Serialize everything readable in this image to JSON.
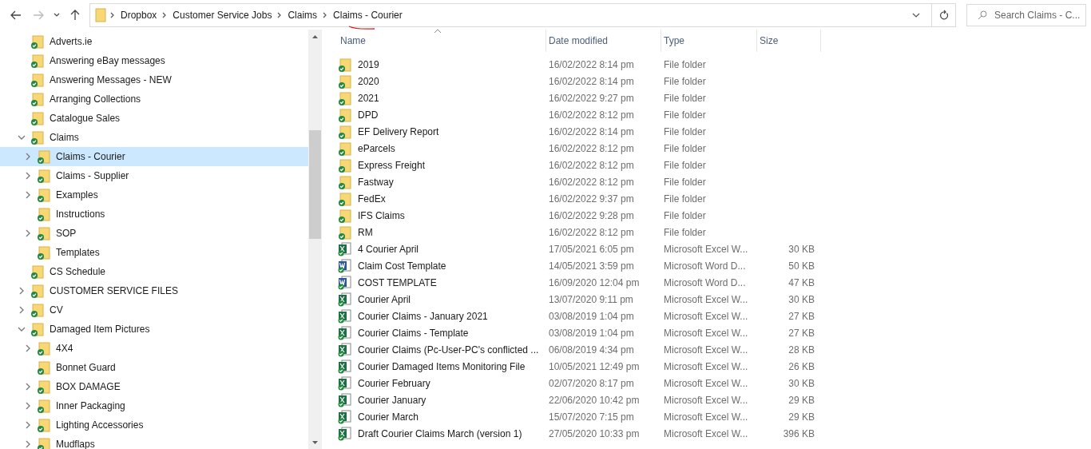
{
  "address_bar": {
    "path": [
      "Dropbox",
      "Customer Service Jobs",
      "Claims",
      "Claims - Courier"
    ]
  },
  "search": {
    "placeholder": "Search Claims - C..."
  },
  "sidebar": {
    "items": [
      {
        "label": "Adverts.ie",
        "kind": "leaf",
        "selected": false
      },
      {
        "label": "Answering eBay messages",
        "kind": "leaf",
        "selected": false
      },
      {
        "label": "Answering Messages - NEW",
        "kind": "leaf",
        "selected": false
      },
      {
        "label": "Arranging Collections",
        "kind": "leaf",
        "selected": false
      },
      {
        "label": "Catalogue Sales",
        "kind": "leaf",
        "selected": false
      },
      {
        "label": "Claims",
        "kind": "open",
        "selected": false,
        "children": [
          {
            "label": "Claims - Courier",
            "kind": "closed",
            "selected": true
          },
          {
            "label": "Claims - Supplier",
            "kind": "closed",
            "selected": false
          },
          {
            "label": "Examples",
            "kind": "closed",
            "selected": false
          },
          {
            "label": "Instructions",
            "kind": "leaf",
            "selected": false
          },
          {
            "label": "SOP",
            "kind": "closed",
            "selected": false
          },
          {
            "label": "Templates",
            "kind": "leaf",
            "selected": false
          }
        ]
      },
      {
        "label": "CS Schedule",
        "kind": "leaf",
        "selected": false
      },
      {
        "label": "CUSTOMER SERVICE FILES",
        "kind": "closed",
        "selected": false
      },
      {
        "label": "CV",
        "kind": "closed",
        "selected": false
      },
      {
        "label": "Damaged Item Pictures",
        "kind": "open",
        "selected": false,
        "children": [
          {
            "label": "4X4",
            "kind": "closed",
            "selected": false
          },
          {
            "label": "Bonnet Guard",
            "kind": "leaf",
            "selected": false
          },
          {
            "label": "BOX DAMAGE",
            "kind": "closed",
            "selected": false
          },
          {
            "label": "Inner Packaging",
            "kind": "closed",
            "selected": false
          },
          {
            "label": "Lighting Accessories",
            "kind": "closed",
            "selected": false
          },
          {
            "label": "Mudflaps",
            "kind": "closed",
            "selected": false
          }
        ]
      }
    ]
  },
  "table": {
    "columns": [
      "Name",
      "Date modified",
      "Type",
      "Size"
    ],
    "rows": [
      {
        "kind": "folder",
        "name": "2019",
        "date": "16/02/2022 8:14 pm",
        "type": "File folder"
      },
      {
        "kind": "folder",
        "name": "2020",
        "date": "16/02/2022 8:14 pm",
        "type": "File folder"
      },
      {
        "kind": "folder",
        "name": "2021",
        "date": "16/02/2022 9:27 pm",
        "type": "File folder"
      },
      {
        "kind": "folder",
        "name": "DPD",
        "date": "16/02/2022 8:12 pm",
        "type": "File folder"
      },
      {
        "kind": "folder",
        "name": "EF Delivery Report",
        "date": "16/02/2022 8:14 pm",
        "type": "File folder"
      },
      {
        "kind": "folder",
        "name": "eParcels",
        "date": "16/02/2022 8:12 pm",
        "type": "File folder"
      },
      {
        "kind": "folder",
        "name": "Express Freight",
        "date": "16/02/2022 8:12 pm",
        "type": "File folder"
      },
      {
        "kind": "folder",
        "name": "Fastway",
        "date": "16/02/2022 8:12 pm",
        "type": "File folder"
      },
      {
        "kind": "folder",
        "name": "FedEx",
        "date": "16/02/2022 9:37 pm",
        "type": "File folder"
      },
      {
        "kind": "folder",
        "name": "IFS Claims",
        "date": "16/02/2022 9:28 pm",
        "type": "File folder"
      },
      {
        "kind": "folder",
        "name": "RM",
        "date": "16/02/2022 8:12 pm",
        "type": "File folder"
      },
      {
        "kind": "excel",
        "name": "4 Courier April",
        "date": "17/05/2021 6:05 pm",
        "type": "Microsoft Excel W...",
        "size": "30 KB"
      },
      {
        "kind": "word",
        "name": "Claim Cost Template",
        "date": "14/05/2021 3:59 pm",
        "type": "Microsoft Word D...",
        "size": "50 KB"
      },
      {
        "kind": "word",
        "name": "COST TEMPLATE",
        "date": "16/09/2020 12:04 pm",
        "type": "Microsoft Word D...",
        "size": "47 KB"
      },
      {
        "kind": "excel",
        "name": "Courier April",
        "date": "13/07/2020 9:11 pm",
        "type": "Microsoft Excel W...",
        "size": "30 KB"
      },
      {
        "kind": "excel",
        "name": "Courier Claims - January 2021",
        "date": "03/08/2019 1:04 pm",
        "type": "Microsoft Excel W...",
        "size": "27 KB"
      },
      {
        "kind": "excel",
        "name": "Courier Claims - Template",
        "date": "03/08/2019 1:04 pm",
        "type": "Microsoft Excel W...",
        "size": "27 KB"
      },
      {
        "kind": "excel",
        "name": "Courier Claims (Pc-User-PC's conflicted ...",
        "date": "06/08/2019 4:34 pm",
        "type": "Microsoft Excel W...",
        "size": "28 KB"
      },
      {
        "kind": "excel",
        "name": "Courier Damaged Items Monitoring File",
        "date": "10/05/2021 12:49 pm",
        "type": "Microsoft Excel W...",
        "size": "26 KB"
      },
      {
        "kind": "excel",
        "name": "Courier February",
        "date": "02/07/2020 8:17 pm",
        "type": "Microsoft Excel W...",
        "size": "30 KB"
      },
      {
        "kind": "excel",
        "name": "Courier January",
        "date": "22/06/2020 10:42 pm",
        "type": "Microsoft Excel W...",
        "size": "29 KB"
      },
      {
        "kind": "excel",
        "name": "Courier March",
        "date": "15/07/2020 7:15 pm",
        "type": "Microsoft Excel W...",
        "size": "29 KB"
      },
      {
        "kind": "excel",
        "name": "Draft Courier Claims March (version 1)",
        "date": "27/05/2020 10:33 pm",
        "type": "Microsoft Excel W...",
        "size": "396 KB"
      }
    ]
  }
}
